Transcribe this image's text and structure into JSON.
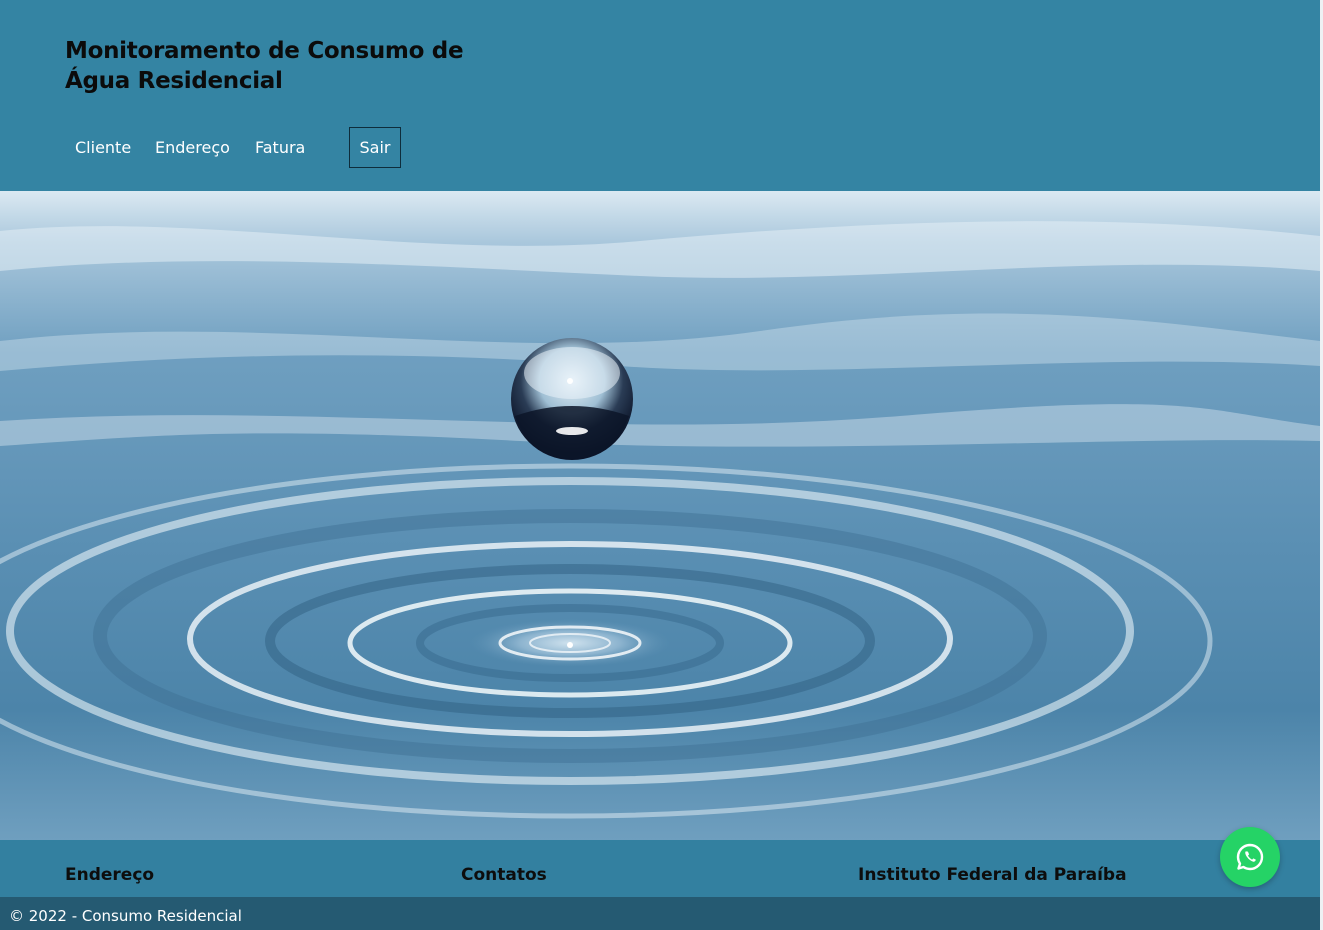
{
  "header": {
    "title_line1": "Monitoramento de Consumo de",
    "title_line2": "Água Residencial",
    "nav": {
      "cliente": "Cliente",
      "endereco": "Endereço",
      "fatura": "Fatura",
      "logout": "Sair"
    }
  },
  "hero": {
    "icon": "water-drop-image"
  },
  "footer": {
    "headings": {
      "endereco": "Endereço",
      "contatos": "Contatos",
      "instituto": "Instituto Federal da Paraíba"
    },
    "copyright": "© 2022 - Consumo Residencial"
  },
  "whatsapp": {
    "icon": "whatsapp-icon",
    "color": "#25d366"
  },
  "colors": {
    "header_bg": "#3484a3",
    "footer_bg": "#3380a0",
    "copyright_bg": "#255a72"
  }
}
